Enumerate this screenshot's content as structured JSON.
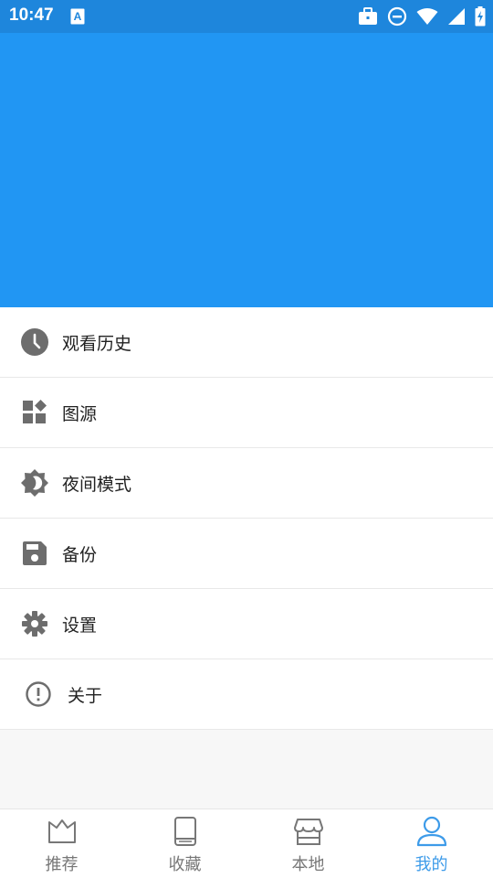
{
  "status_bar": {
    "time": "10:47",
    "icons": [
      "keyboard-a-icon",
      "briefcase-icon",
      "do-not-disturb-icon",
      "wifi-icon",
      "cellular-signal-icon",
      "battery-charging-icon"
    ]
  },
  "header": {
    "banner_color": "#2196f3"
  },
  "menu": {
    "items": [
      {
        "icon": "history-clock-icon",
        "label": "观看历史"
      },
      {
        "icon": "widgets-icon",
        "label": "图源"
      },
      {
        "icon": "night-mode-icon",
        "label": "夜间模式"
      },
      {
        "icon": "save-floppy-icon",
        "label": "备份"
      },
      {
        "icon": "settings-gear-icon",
        "label": "设置"
      },
      {
        "icon": "info-alert-icon",
        "label": "关于"
      }
    ]
  },
  "bottom_nav": {
    "items": [
      {
        "icon": "crown-icon",
        "label": "推荐",
        "active": false
      },
      {
        "icon": "book-icon",
        "label": "收藏",
        "active": false
      },
      {
        "icon": "store-icon",
        "label": "本地",
        "active": false
      },
      {
        "icon": "person-icon",
        "label": "我的",
        "active": true
      }
    ],
    "active_color": "#3d9be9",
    "inactive_color": "#777777"
  }
}
